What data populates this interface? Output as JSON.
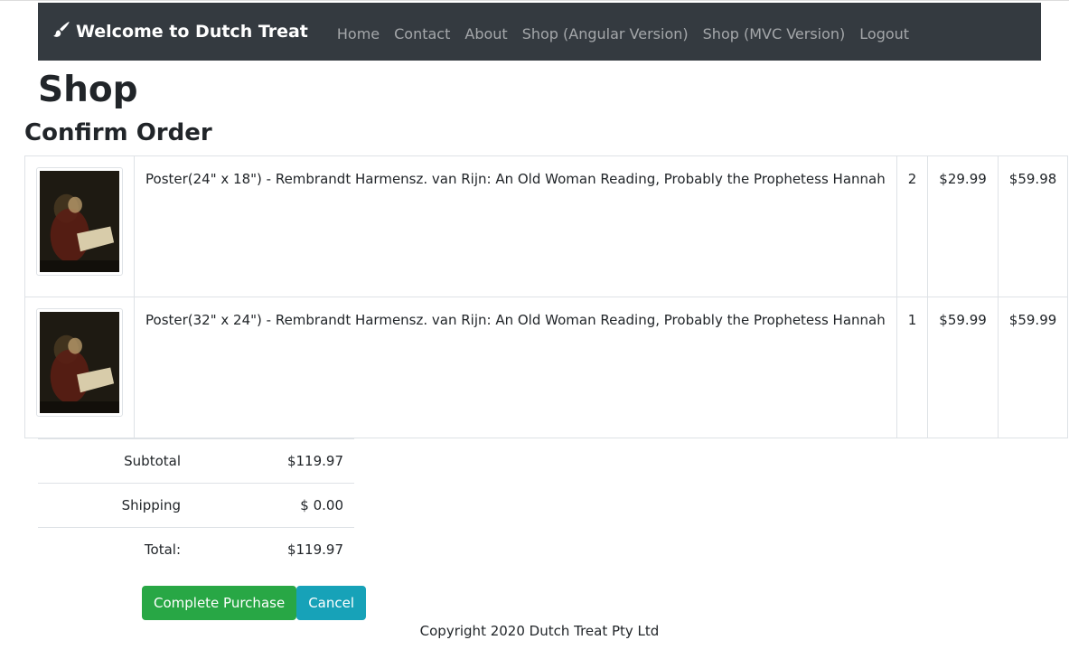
{
  "navbar": {
    "brand": "Welcome to Dutch Treat",
    "brand_icon": "paint-brush-icon",
    "links": [
      "Home",
      "Contact",
      "About",
      "Shop (Angular Version)",
      "Shop (MVC Version)",
      "Logout"
    ]
  },
  "page_title": "Shop",
  "section_title": "Confirm Order",
  "order_items": [
    {
      "image": "rembrandt-old-woman-reading-thumbnail",
      "description": "Poster(24\" x 18\") - Rembrandt Harmensz. van Rijn: An Old Woman Reading, Probably the Prophetess Hannah",
      "quantity": "2",
      "unit_price": "$29.99",
      "line_total": "$59.98"
    },
    {
      "image": "rembrandt-old-woman-reading-thumbnail",
      "description": "Poster(32\" x 24\") - Rembrandt Harmensz. van Rijn: An Old Woman Reading, Probably the Prophetess Hannah",
      "quantity": "1",
      "unit_price": "$59.99",
      "line_total": "$59.99"
    }
  ],
  "totals": {
    "subtotal_label": "Subtotal",
    "subtotal_value": "$119.97",
    "shipping_label": "Shipping",
    "shipping_value": "$ 0.00",
    "total_label": "Total:",
    "total_value": "$119.97"
  },
  "actions": {
    "complete_label": "Complete Purchase",
    "cancel_label": "Cancel"
  },
  "footer": "Copyright 2020 Dutch Treat Pty Ltd",
  "colors": {
    "navbar_bg": "#343a40",
    "success": "#28a745",
    "info": "#17a2b8"
  }
}
